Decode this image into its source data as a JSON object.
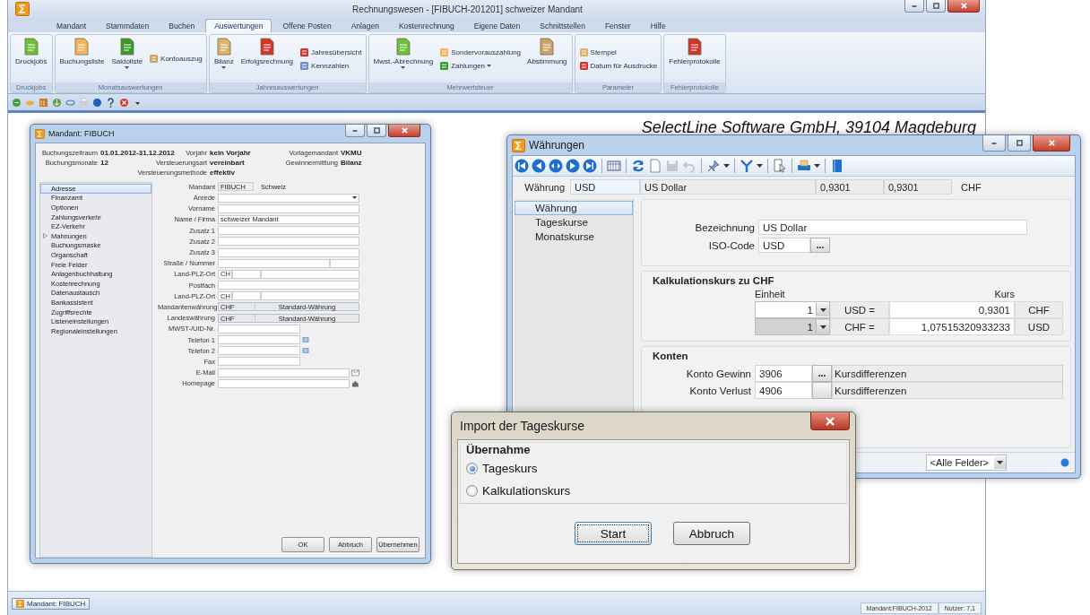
{
  "window": {
    "title": "Rechnungswesen - [FIBUCH-201201] schweizer Mandant"
  },
  "tabs": [
    {
      "label": "Mandant",
      "selected": false
    },
    {
      "label": "Stammdaten",
      "selected": false
    },
    {
      "label": "Buchen",
      "selected": false
    },
    {
      "label": "Auswertungen",
      "selected": true
    },
    {
      "label": "Offene Posten",
      "selected": false
    },
    {
      "label": "Anlagen",
      "selected": false
    },
    {
      "label": "Kostenrechnung",
      "selected": false
    },
    {
      "label": "Eigene Daten",
      "selected": false
    },
    {
      "label": "Schnittstellen",
      "selected": false
    },
    {
      "label": "Fenster",
      "selected": false
    },
    {
      "label": "Hilfe",
      "selected": false
    }
  ],
  "ribbon": {
    "groups": [
      {
        "label": "Druckjobs",
        "items": [
          {
            "label": "Druckjobs",
            "kind": "large",
            "dropdown": false
          }
        ]
      },
      {
        "label": "Monatsauswertungen",
        "items": [
          {
            "label": "Buchungsliste",
            "kind": "large",
            "dropdown": false
          },
          {
            "label": "Saldoliste",
            "kind": "large",
            "dropdown": true
          },
          {
            "label": "Kontoauszug",
            "kind": "small",
            "dropdown": false
          }
        ]
      },
      {
        "label": "Jahresauswertungen",
        "items": [
          {
            "label": "Bilanz",
            "kind": "large",
            "dropdown": true
          },
          {
            "label": "Erfolgsrechnung",
            "kind": "large",
            "dropdown": false
          },
          {
            "label": "Jahresübersicht",
            "kind": "small",
            "dropdown": false
          },
          {
            "label": "Kennzahlen",
            "kind": "small",
            "dropdown": false
          }
        ]
      },
      {
        "label": "Mehrwertsteuer",
        "items": [
          {
            "label": "Mwst.-Abrechnung",
            "kind": "large",
            "dropdown": true
          },
          {
            "label": "Sondervorauszahlung",
            "kind": "small",
            "dropdown": false
          },
          {
            "label": "Zahlungen",
            "kind": "small",
            "dropdown": true
          },
          {
            "label": "Abstimmung",
            "kind": "large",
            "dropdown": false
          }
        ]
      },
      {
        "label": "Parameter",
        "items": [
          {
            "label": "Stempel",
            "kind": "small",
            "dropdown": false
          },
          {
            "label": "Datum für Ausdrucke",
            "kind": "small",
            "dropdown": false
          }
        ]
      },
      {
        "label": "Fehlerprotokolle",
        "items": [
          {
            "label": "Fehlerprotokolle",
            "kind": "large",
            "dropdown": false
          }
        ]
      }
    ]
  },
  "company_banner": "SelectLine Software GmbH, 39104 Magdeburg",
  "mandant_dialog": {
    "title": "Mandant: FIBUCH",
    "header": [
      [
        {
          "label": "Buchungszeitraum",
          "value": "01.01.2012-31.12.2012"
        },
        {
          "label": "Vorjahr",
          "value": "kein Vorjahr"
        },
        {
          "label": "Vorlagemandant",
          "value": "VKMU"
        }
      ],
      [
        {
          "label": "Buchungsmonate",
          "value": "12"
        },
        {
          "label": "Versteuerungsart",
          "value": "vereinbart"
        },
        {
          "label": "Gewinnermittlung",
          "value": "Bilanz"
        }
      ],
      [
        {
          "label": "Versteuerungsmethode",
          "value": "effektiv"
        }
      ]
    ],
    "nav": [
      {
        "label": "Adresse",
        "selected": true,
        "expandable": false
      },
      {
        "label": "Finanzamt",
        "selected": false,
        "expandable": false
      },
      {
        "label": "Optionen",
        "selected": false,
        "expandable": false
      },
      {
        "label": "Zahlungsverkehr",
        "selected": false,
        "expandable": false
      },
      {
        "label": "EZ-Verkehr",
        "selected": false,
        "expandable": false
      },
      {
        "label": "Mahnungen",
        "selected": false,
        "expandable": true
      },
      {
        "label": "Buchungsmaske",
        "selected": false,
        "expandable": false
      },
      {
        "label": "Organschaft",
        "selected": false,
        "expandable": false
      },
      {
        "label": "Freie Felder",
        "selected": false,
        "expandable": false
      },
      {
        "label": "Anlagenbuchhaltung",
        "selected": false,
        "expandable": false
      },
      {
        "label": "Kostenrechnung",
        "selected": false,
        "expandable": false
      },
      {
        "label": "Datenaustausch",
        "selected": false,
        "expandable": false
      },
      {
        "label": "Bankassistent",
        "selected": false,
        "expandable": false
      },
      {
        "label": "Zugriffsrechte",
        "selected": false,
        "expandable": false
      },
      {
        "label": "Listeneinstellungen",
        "selected": false,
        "expandable": false
      },
      {
        "label": "Regionaleinstellungen",
        "selected": false,
        "expandable": false
      }
    ],
    "fields": [
      {
        "label": "Mandant",
        "kind": "readonly",
        "value": "FIBUCH",
        "note": "Schweiz"
      },
      {
        "label": "Anrede",
        "kind": "dropdown"
      },
      {
        "label": "Vorname",
        "kind": "text"
      },
      {
        "label": "Name / Firma",
        "kind": "text",
        "value": "schweizer Mandant"
      },
      {
        "label": "Zusatz 1",
        "kind": "text"
      },
      {
        "label": "Zusatz 2",
        "kind": "text"
      },
      {
        "label": "Zusatz 3",
        "kind": "text"
      },
      {
        "label": "Straße / Nummer",
        "kind": "street"
      },
      {
        "label": "Land-PLZ-Ort",
        "kind": "place",
        "value": "CH"
      },
      {
        "label": "Postfach",
        "kind": "text"
      },
      {
        "label": "Land-PLZ-Ort",
        "kind": "place",
        "value": "CH"
      },
      {
        "label": "Mandantenwährung",
        "kind": "currency",
        "value": "CHF",
        "note": "Standard-Währung"
      },
      {
        "label": "Landeswährung",
        "kind": "currency",
        "value": "CHF",
        "note": "Standard-Währung"
      },
      {
        "label": "MWST-/UID-Nr.",
        "kind": "short"
      },
      {
        "label": "Telefon 1",
        "kind": "phone"
      },
      {
        "label": "Telefon 2",
        "kind": "phone"
      },
      {
        "label": "Fax",
        "kind": "short"
      },
      {
        "label": "E-Mail",
        "kind": "email"
      },
      {
        "label": "Homepage",
        "kind": "web"
      }
    ],
    "buttons": [
      "OK",
      "Abbruch",
      "Übernehmen"
    ]
  },
  "currency_window": {
    "title": "Währungen",
    "record": {
      "label": "Währung",
      "code": "USD",
      "name": "US Dollar",
      "rate_1": "0,9301",
      "rate_2": "0,9301",
      "unit": "CHF"
    },
    "nav": [
      {
        "label": "Währung",
        "selected": true
      },
      {
        "label": "Tageskurse",
        "selected": false
      },
      {
        "label": "Monatskurse",
        "selected": false
      }
    ],
    "description": {
      "label": "Bezeichnung",
      "value": "US Dollar"
    },
    "iso_code": {
      "label": "ISO-Code",
      "value": "USD",
      "button": "..."
    },
    "rate_section": {
      "title": "Kalkulationskurs zu CHF",
      "unit_header": "Einheit",
      "rate_header": "Kurs",
      "rows": [
        {
          "unit": "1",
          "editable": true,
          "from": "USD =",
          "rate": "0,9301",
          "to": "CHF"
        },
        {
          "unit": "1",
          "editable": false,
          "from": "CHF =",
          "rate": "1,07515320933233",
          "to": "USD"
        }
      ]
    },
    "accounts_section": {
      "title": "Konten",
      "rows": [
        {
          "label": "Konto Gewinn",
          "account": "3906",
          "button": "...",
          "name": "Kursdifferenzen"
        },
        {
          "label": "Konto Verlust",
          "account": "4906",
          "name": "Kursdifferenzen"
        }
      ]
    },
    "field_filter": "<Alle Felder>"
  },
  "import_dialog": {
    "title": "Import der Tageskurse",
    "group": "Übernahme",
    "options": [
      {
        "label": "Tageskurs",
        "selected": true
      },
      {
        "label": "Kalkulationskurs",
        "selected": false
      }
    ],
    "buttons": [
      {
        "label": "Start",
        "focused": true
      },
      {
        "label": "Abbruch",
        "focused": false
      }
    ]
  },
  "status_bar": {
    "task": "Mandant: FIBUCH",
    "mandant": "Mandant:FIBUCH-2012",
    "user": "Nutzer: 7,1"
  }
}
